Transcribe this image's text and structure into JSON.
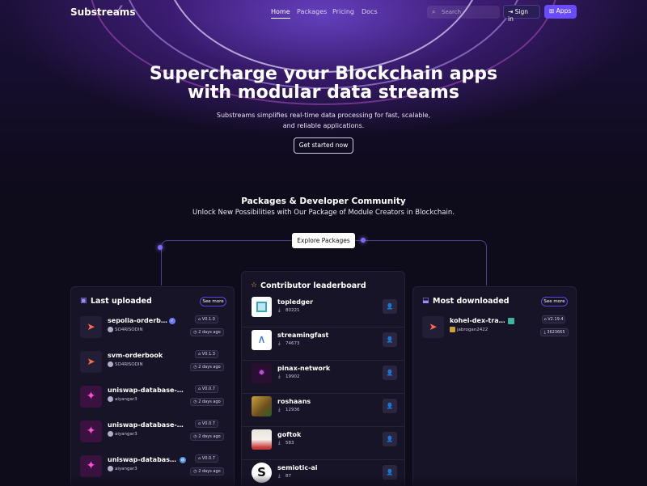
{
  "nav": {
    "logo": "Substreams",
    "links": [
      "Home",
      "Packages",
      "Pricing",
      "Docs"
    ],
    "search_placeholder": "Search",
    "signin": "Sign in",
    "apps": "Apps"
  },
  "hero": {
    "title_line1": "Supercharge your Blockchain apps",
    "title_line2": "with modular data streams",
    "subtitle_line1": "Substreams simplifies real-time data processing for fast, scalable,",
    "subtitle_line2": "and reliable applications.",
    "cta": "Get started now"
  },
  "community": {
    "title": "Packages & Developer Community",
    "subtitle": "Unlock New Possibilities with Our Package of Module Creators in Blockchain.",
    "explore": "Explore Packages"
  },
  "last_uploaded": {
    "title": "Last uploaded",
    "see_more": "See more",
    "items": [
      {
        "name": "sepolia-orderbook",
        "author": "SO4RISODIN",
        "version": "V0.1.0",
        "date": "2 days ago",
        "thumb": "streamingfast-icon"
      },
      {
        "name": "svm-orderbook",
        "author": "SO4RISODIN",
        "version": "V0.1.3",
        "date": "2 days ago",
        "thumb": "streamingfast-icon"
      },
      {
        "name": "uniswap-database-ch...",
        "author": "aiyangar3",
        "version": "V0.0.7",
        "date": "2 days ago",
        "thumb": "unicorn-icon"
      },
      {
        "name": "uniswap-database-ch...",
        "author": "aiyangar3",
        "version": "V0.0.7",
        "date": "2 days ago",
        "thumb": "unicorn-icon"
      },
      {
        "name": "uniswap-database-...",
        "author": "aiyangar3",
        "version": "V0.0.7",
        "date": "2 days ago",
        "thumb": "unicorn-icon"
      }
    ]
  },
  "leaderboard": {
    "title": "Contributor leaderboard",
    "items": [
      {
        "name": "topledger",
        "count": "80221"
      },
      {
        "name": "streamingfast",
        "count": "74673"
      },
      {
        "name": "pinax-network",
        "count": "19902"
      },
      {
        "name": "roshaans",
        "count": "12936"
      },
      {
        "name": "goftok",
        "count": "583"
      },
      {
        "name": "semiotic-ai",
        "count": "87"
      }
    ]
  },
  "most_downloaded": {
    "title": "Most downloaded",
    "see_more": "See more",
    "items": [
      {
        "name": "kohei-dex-trades",
        "author": "jabrogan2422",
        "version": "V2.19.4",
        "downloads": "3623665"
      }
    ]
  },
  "colors": {
    "accent": "#6a4cff",
    "background": "#0e0b1a",
    "panel": "#171427"
  }
}
